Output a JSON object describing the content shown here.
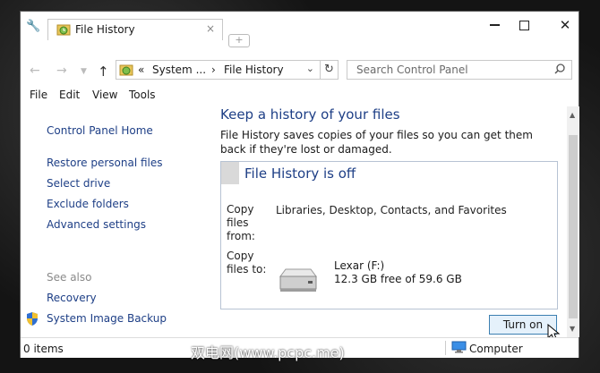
{
  "window": {
    "tab_title": "File History",
    "tab_close": "×",
    "new_tab": "+",
    "close_glyph": "✕"
  },
  "address": {
    "prefix": "«",
    "crumb1": "System ...",
    "sep": "›",
    "crumb2": "File History",
    "search_placeholder": "Search Control Panel"
  },
  "menu": [
    "File",
    "Edit",
    "View",
    "Tools"
  ],
  "sidebar": {
    "items": [
      {
        "label": "Control Panel Home"
      },
      {
        "label": "Restore personal files"
      },
      {
        "label": "Select drive"
      },
      {
        "label": "Exclude folders"
      },
      {
        "label": "Advanced settings"
      }
    ],
    "see_also_label": "See also",
    "see_also": [
      {
        "label": "Recovery"
      },
      {
        "label": "System Image Backup"
      }
    ]
  },
  "main": {
    "heading": "Keep a history of your files",
    "description": "File History saves copies of your files so you can get them back if they're lost or damaged.",
    "status_title": "File History is off",
    "copy_from_label": "Copy files from:",
    "copy_from_value": "Libraries, Desktop, Contacts, and Favorites",
    "copy_to_label": "Copy files to:",
    "drive_name": "Lexar (F:)",
    "drive_space": "12.3 GB free of 59.6 GB",
    "turn_on": "Turn on"
  },
  "status": {
    "items": "0 items",
    "location": "Computer"
  },
  "watermark": "双电网(www.pcpc.me)",
  "colors": {
    "link": "#1e3f86",
    "button_border": "#3c7fb1",
    "button_fill": "#e5f1fb"
  }
}
